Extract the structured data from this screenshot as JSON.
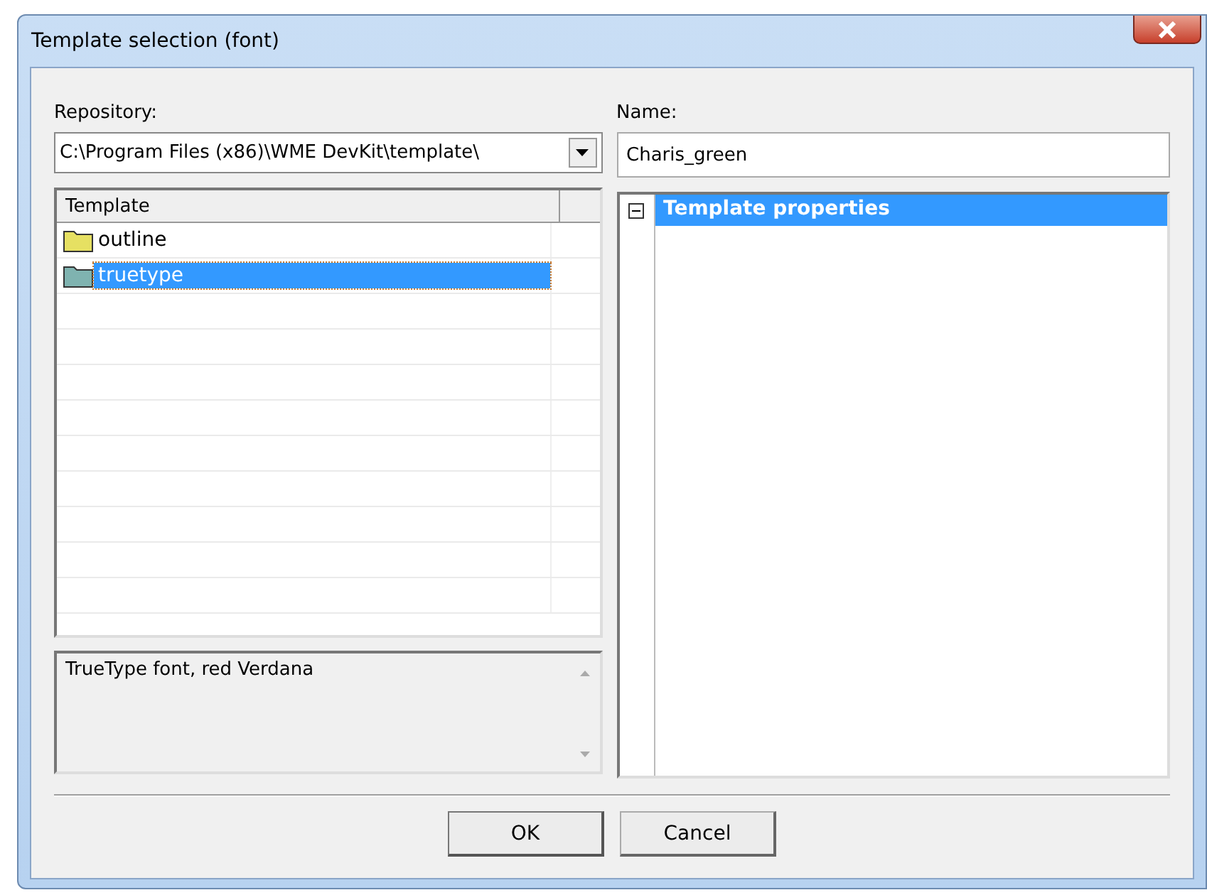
{
  "window": {
    "title": "Template selection (font)"
  },
  "repository": {
    "label": "Repository:",
    "value": "C:\\Program Files (x86)\\WME DevKit\\template\\"
  },
  "name": {
    "label": "Name:",
    "value": "Charis_green"
  },
  "templates": {
    "column": "Template",
    "items": [
      {
        "label": "outline",
        "selected": false
      },
      {
        "label": "truetype",
        "selected": true
      }
    ]
  },
  "description": "TrueType font, red Verdana",
  "properties": {
    "label": "Template properties",
    "expanded": true,
    "selected": true
  },
  "buttons": [
    {
      "label": "OK",
      "default": true
    },
    {
      "label": "Cancel",
      "default": false
    }
  ]
}
